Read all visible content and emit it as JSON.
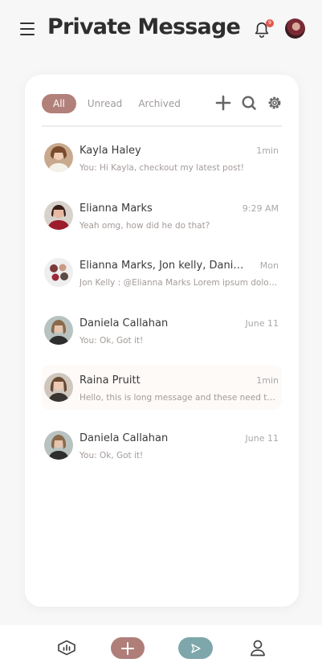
{
  "header": {
    "title": "Private Message",
    "notification_count": "9"
  },
  "tabs": [
    {
      "label": "All"
    },
    {
      "label": "Unread"
    },
    {
      "label": "Archived"
    }
  ],
  "messages": [
    {
      "name": "Kayla Haley",
      "time": "1min",
      "preview": "You: Hi Kayla, checkout my latest post!"
    },
    {
      "name": "Elianna Marks",
      "time": "9:29 AM",
      "preview": "Yeah omg, how did he do that?"
    },
    {
      "name": "Elianna Marks, Jon kelly, Daniela Callahan",
      "time": "Mon",
      "preview": "Jon Kelly : @Elianna Marks Lorem ipsum dolor sit amet"
    },
    {
      "name": "Daniela Callahan",
      "time": "June 11",
      "preview": "You: Ok, Got it!"
    },
    {
      "name": "Raina Pruitt",
      "time": "1min",
      "preview": "Hello, this is long message and these need to be truncated"
    },
    {
      "name": "Daniela Callahan",
      "time": "June 11",
      "preview": "You: Ok, Got it!"
    }
  ],
  "colors": {
    "accent": "#b2807a",
    "send": "#7ea7ab",
    "badge": "#e2574c"
  }
}
